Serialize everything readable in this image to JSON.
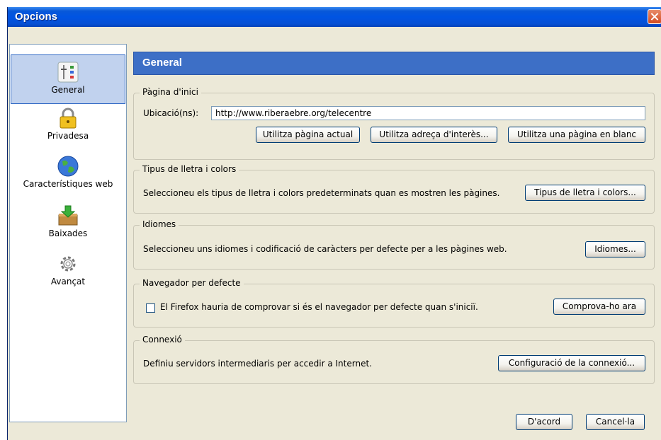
{
  "window": {
    "title": "Opcions"
  },
  "sidebar": {
    "items": [
      {
        "label": "General",
        "icon": "general-settings-icon",
        "selected": true
      },
      {
        "label": "Privadesa",
        "icon": "padlock-icon"
      },
      {
        "label": "Característiques web",
        "icon": "globe-icon"
      },
      {
        "label": "Baixades",
        "icon": "download-box-icon"
      },
      {
        "label": "Avançat",
        "icon": "gear-icon"
      }
    ]
  },
  "panel": {
    "title": "General",
    "homepage": {
      "legend": "Pàgina d'inici",
      "location_label": "Ubicació(ns):",
      "location_value": "http://www.riberaebre.org/telecentre",
      "buttons": {
        "current": "Utilitza pàgina actual",
        "bookmark": "Utilitza adreça d'interès...",
        "blank": "Utilitza una pàgina en blanc"
      }
    },
    "fonts": {
      "legend": "Tipus de lletra i colors",
      "description": "Seleccioneu els tipus de lletra i colors predeterminats quan es mostren les pàgines.",
      "button": "Tipus de lletra i colors..."
    },
    "languages": {
      "legend": "Idiomes",
      "description": "Seleccioneu uns idiomes i codificació de caràcters per defecte per a les pàgines web.",
      "button": "Idiomes..."
    },
    "default_browser": {
      "legend": "Navegador per defecte",
      "checkbox_label": "El Firefox hauria de comprovar si és el navegador per defecte quan s'iniciï.",
      "checked": false,
      "button": "Comprova-ho ara"
    },
    "connection": {
      "legend": "Connexió",
      "description": "Definiu servidors intermediaris per accedir a Internet.",
      "button": "Configuració de la connexió..."
    }
  },
  "footer": {
    "ok": "D'acord",
    "cancel": "Cancel·la"
  },
  "colors": {
    "title_bar": "#0054e3",
    "header": "#3d6fc6",
    "dialog_bg": "#ece9d8",
    "selected_bg": "#c1d2ee"
  }
}
